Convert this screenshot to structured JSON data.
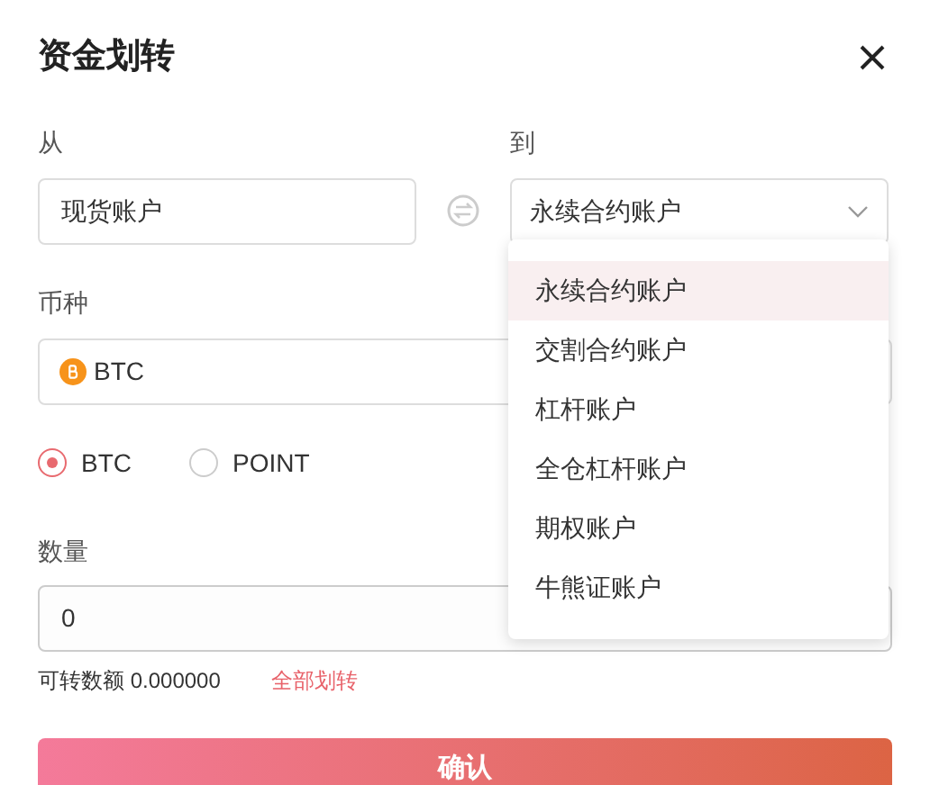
{
  "dialog": {
    "title": "资金划转"
  },
  "from": {
    "label": "从",
    "value": "现货账户"
  },
  "to": {
    "label": "到",
    "value": "永续合约账户",
    "expanded": true,
    "options": [
      {
        "label": "永续合约账户",
        "selected": true
      },
      {
        "label": "交割合约账户",
        "selected": false
      },
      {
        "label": "杠杆账户",
        "selected": false
      },
      {
        "label": "全仓杠杆账户",
        "selected": false
      },
      {
        "label": "期权账户",
        "selected": false
      },
      {
        "label": "牛熊证账户",
        "selected": false
      }
    ]
  },
  "coin": {
    "label": "币种",
    "value": "BTC"
  },
  "radios": [
    {
      "label": "BTC",
      "selected": true
    },
    {
      "label": "POINT",
      "selected": false
    }
  ],
  "amount": {
    "label": "数量",
    "value": "0"
  },
  "available": {
    "label": "可转数额 0.000000",
    "link": "全部划转"
  },
  "confirm_button": "确认"
}
